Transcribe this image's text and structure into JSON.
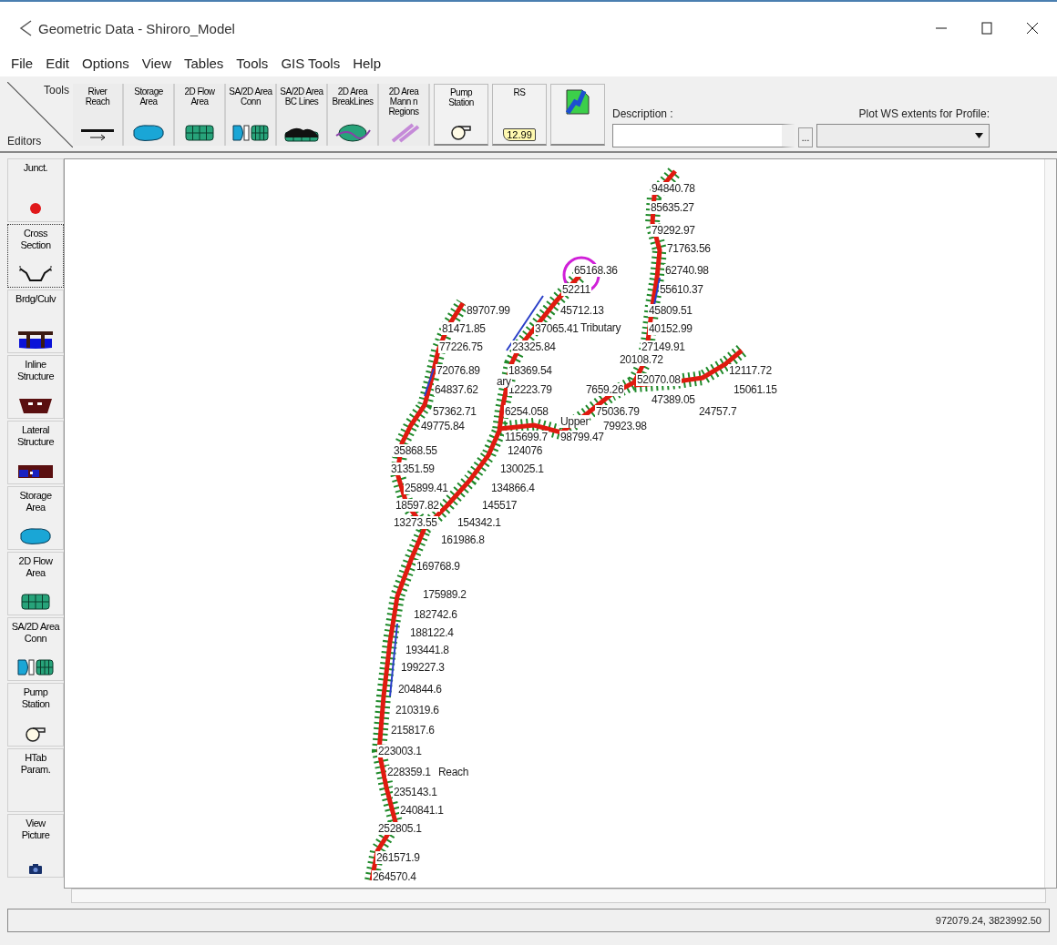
{
  "window": {
    "title": "Geometric Data - Shiroro_Model"
  },
  "menu": [
    "File",
    "Edit",
    "Options",
    "View",
    "Tables",
    "Tools",
    "GIS Tools",
    "Help"
  ],
  "editors_corner": {
    "top": "Tools",
    "bottom": "Editors"
  },
  "toolbar": [
    {
      "label": "River\nReach",
      "kind": "reach"
    },
    {
      "label": "Storage\nArea",
      "kind": "storage"
    },
    {
      "label": "2D Flow\nArea",
      "kind": "flow2d"
    },
    {
      "label": "SA/2D Area\nConn",
      "kind": "conn"
    },
    {
      "label": "SA/2D Area\nBC Lines",
      "kind": "bclines"
    },
    {
      "label": "2D Area\nBreakLines",
      "kind": "breaklines"
    },
    {
      "label": "2D Area\nMann n\nRegions",
      "kind": "mann"
    },
    {
      "label": "Pump\nStation",
      "kind": "pump"
    },
    {
      "label": "RS",
      "kind": "rs",
      "tag": "12.99"
    },
    {
      "kind": "map"
    }
  ],
  "description": {
    "label": "Description :"
  },
  "more_button": "...",
  "profile": {
    "label": "Plot WS extents for Profile:"
  },
  "sidebar": [
    {
      "label": "Junct.",
      "kind": "junction",
      "selected": false
    },
    {
      "label": "Cross\nSection",
      "kind": "xsection",
      "selected": true
    },
    {
      "label": "Brdg/Culv",
      "kind": "bridge",
      "selected": false
    },
    {
      "label": "Inline\nStructure",
      "kind": "inline",
      "selected": false
    },
    {
      "label": "Lateral\nStructure",
      "kind": "lateral",
      "selected": false
    },
    {
      "label": "Storage\nArea",
      "kind": "storage",
      "selected": false
    },
    {
      "label": "2D Flow\nArea",
      "kind": "flow2d",
      "selected": false
    },
    {
      "label": "SA/2D Area\nConn",
      "kind": "conn",
      "selected": false
    },
    {
      "label": "Pump\nStation",
      "kind": "pump",
      "selected": false
    },
    {
      "label": "HTab\nParam.",
      "kind": "htab",
      "selected": false
    },
    {
      "label": "View\nPicture",
      "kind": "camera",
      "selected": false
    }
  ],
  "stations": [
    "94840.78",
    "85635.27",
    "79292.97",
    "71763.56",
    "65168.36",
    "62740.98",
    "52211",
    "55610.37",
    "89707.99",
    "45712.13",
    "45809.51",
    "81471.85",
    "37065.41",
    "40152.99",
    "77226.75",
    "23325.84",
    "27149.91",
    "20108.72",
    "72076.89",
    "18369.54",
    "12117.72",
    "52070.08",
    "64837.62",
    "12223.79",
    "7659.26",
    "15061.15",
    "47389.05",
    "57362.71",
    "6254.058",
    "75036.79",
    "24757.7",
    "49775.84",
    "79923.98",
    "115699.7",
    "98799.47",
    "35868.55",
    "124076",
    "31351.59",
    "130025.1",
    "25899.41",
    "134866.4",
    "18597.82",
    "145517",
    "13273.55",
    "154342.1",
    "161986.8",
    "169768.9",
    "175989.2",
    "182742.6",
    "188122.4",
    "193441.8",
    "199227.3",
    "204844.6",
    "210319.6",
    "215817.6",
    "223003.1",
    "228359.1",
    "235143.1",
    "240841.1",
    "252805.1",
    "261571.9",
    "264570.4"
  ],
  "river_labels": [
    "Tributary",
    "ary",
    "Upper",
    "Reach"
  ],
  "status_bar": {
    "coordinates": "972079.24, 3823992.50"
  }
}
